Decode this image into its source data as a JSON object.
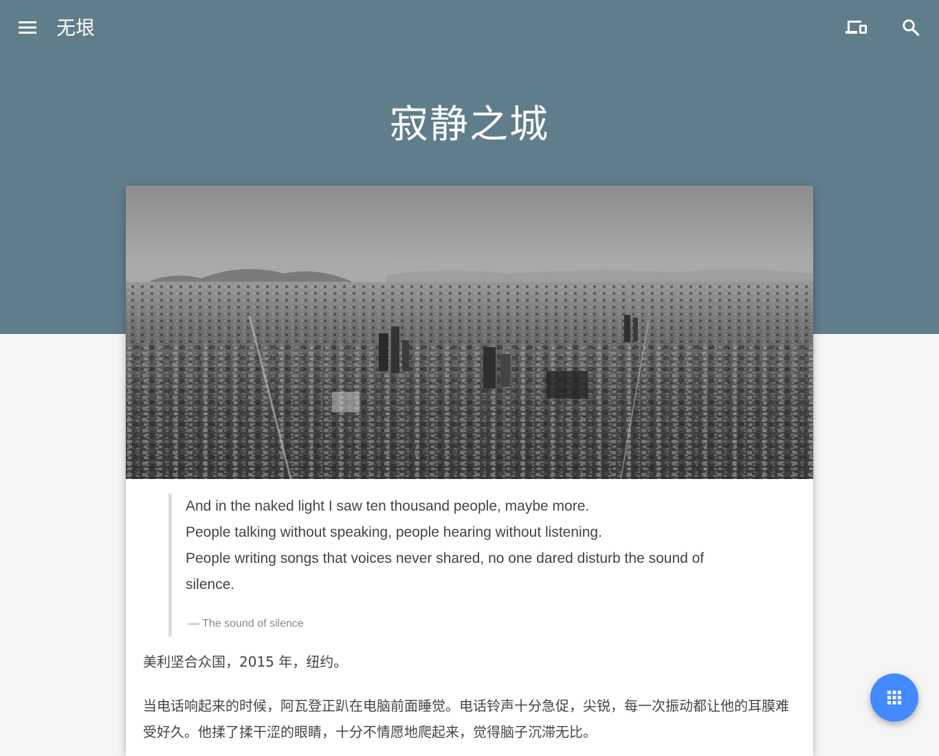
{
  "header": {
    "site_title": "无垠",
    "menu_icon": "menu-icon",
    "device_icon": "devices-icon",
    "search_icon": "search-icon"
  },
  "hero": {
    "page_title": "寂静之城",
    "background_color": "#607d8b"
  },
  "article": {
    "cover_image": "black-and-white aerial city skyline",
    "quote": {
      "lines": [
        "And in the naked light I saw ten thousand people, maybe more.",
        "People talking without speaking, people hearing without listening.",
        "People writing songs that voices never shared, no one dared disturb the sound of",
        "silence."
      ],
      "cite": "— The sound of silence"
    },
    "paragraphs": [
      "美利坚合众国，2015 年，纽约。",
      "当电话响起来的时候，阿瓦登正趴在电脑前面睡觉。电话铃声十分急促，尖锐，每一次振动都让他的耳膜难受好久。他揉了揉干涩的眼睛，十分不情愿地爬起来，觉得脑子沉滞无比。"
    ]
  },
  "fab": {
    "icon": "apps-grid-icon",
    "color": "#448aff"
  }
}
